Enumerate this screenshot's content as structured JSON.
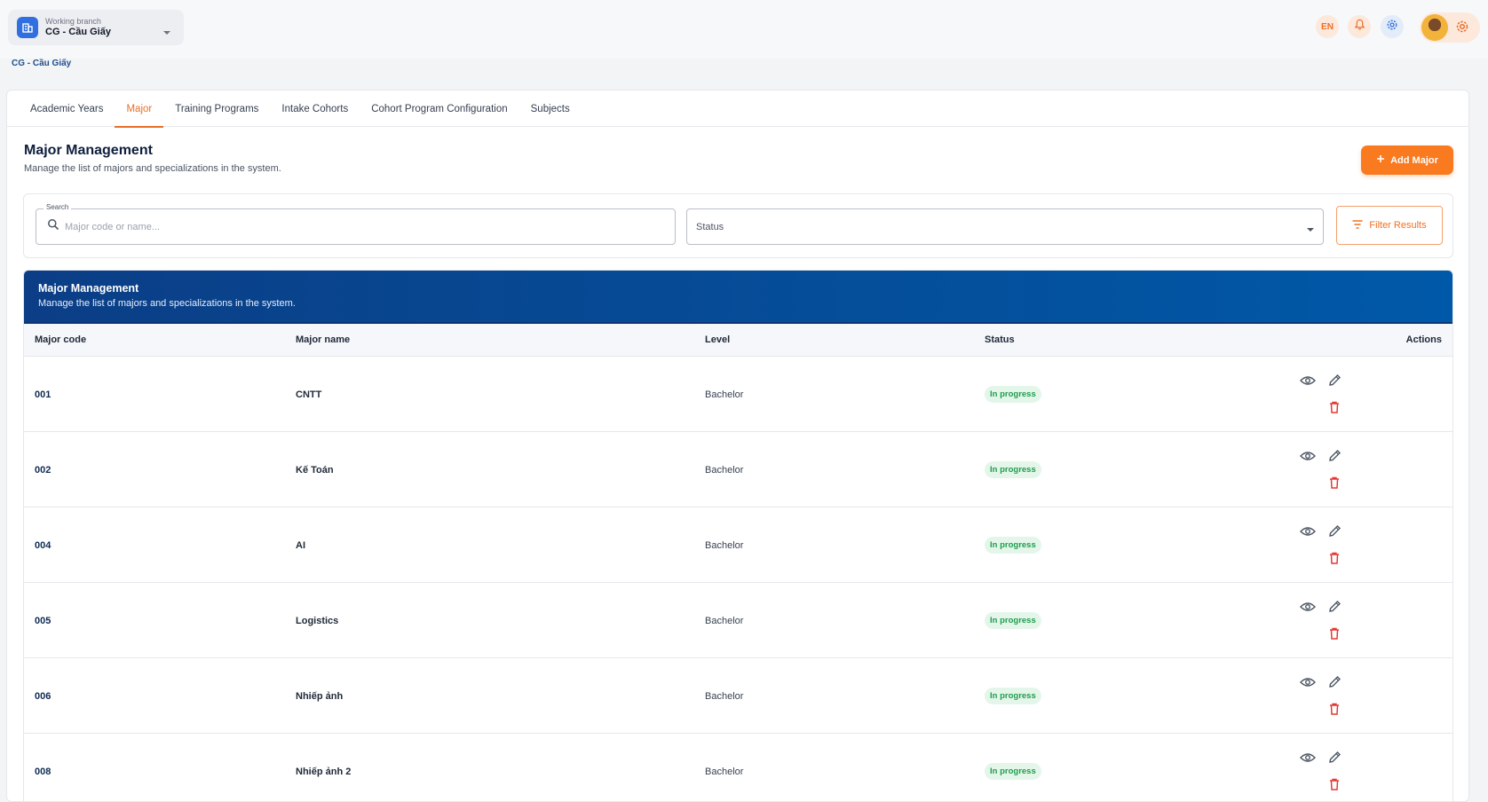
{
  "header": {
    "branch_label": "Working branch",
    "branch_value": "CG - Cầu Giấy",
    "language": "EN"
  },
  "breadcrumb": "CG - Cầu Giấy",
  "tabs": [
    {
      "label": "Academic Years",
      "active": false
    },
    {
      "label": "Major",
      "active": true
    },
    {
      "label": "Training Programs",
      "active": false
    },
    {
      "label": "Intake Cohorts",
      "active": false
    },
    {
      "label": "Cohort Program Configuration",
      "active": false
    },
    {
      "label": "Subjects",
      "active": false
    }
  ],
  "page": {
    "title": "Major Management",
    "subtitle": "Manage the list of majors and specializations in the system.",
    "add_button": "Add Major"
  },
  "filters": {
    "search_label": "Search",
    "search_placeholder": "Major code or name...",
    "status_placeholder": "Status",
    "filter_button": "Filter Results"
  },
  "table": {
    "title": "Major Management",
    "subtitle": "Manage the list of majors and specializations in the system.",
    "columns": {
      "code": "Major code",
      "name": "Major name",
      "level": "Level",
      "status": "Status",
      "actions": "Actions"
    },
    "rows": [
      {
        "code": "001",
        "name": "CNTT",
        "level": "Bachelor",
        "status": "In progress"
      },
      {
        "code": "002",
        "name": "Kế Toán",
        "level": "Bachelor",
        "status": "In progress"
      },
      {
        "code": "004",
        "name": "AI",
        "level": "Bachelor",
        "status": "In progress"
      },
      {
        "code": "005",
        "name": "Logistics",
        "level": "Bachelor",
        "status": "In progress"
      },
      {
        "code": "006",
        "name": "Nhiếp ảnh",
        "level": "Bachelor",
        "status": "In progress"
      },
      {
        "code": "008",
        "name": "Nhiếp ảnh 2",
        "level": "Bachelor",
        "status": "In progress"
      }
    ]
  },
  "colors": {
    "accent": "#f97a1f",
    "header_blue": "#0b3e86",
    "status_green": "#1f9d4c",
    "delete_red": "#e53935"
  }
}
